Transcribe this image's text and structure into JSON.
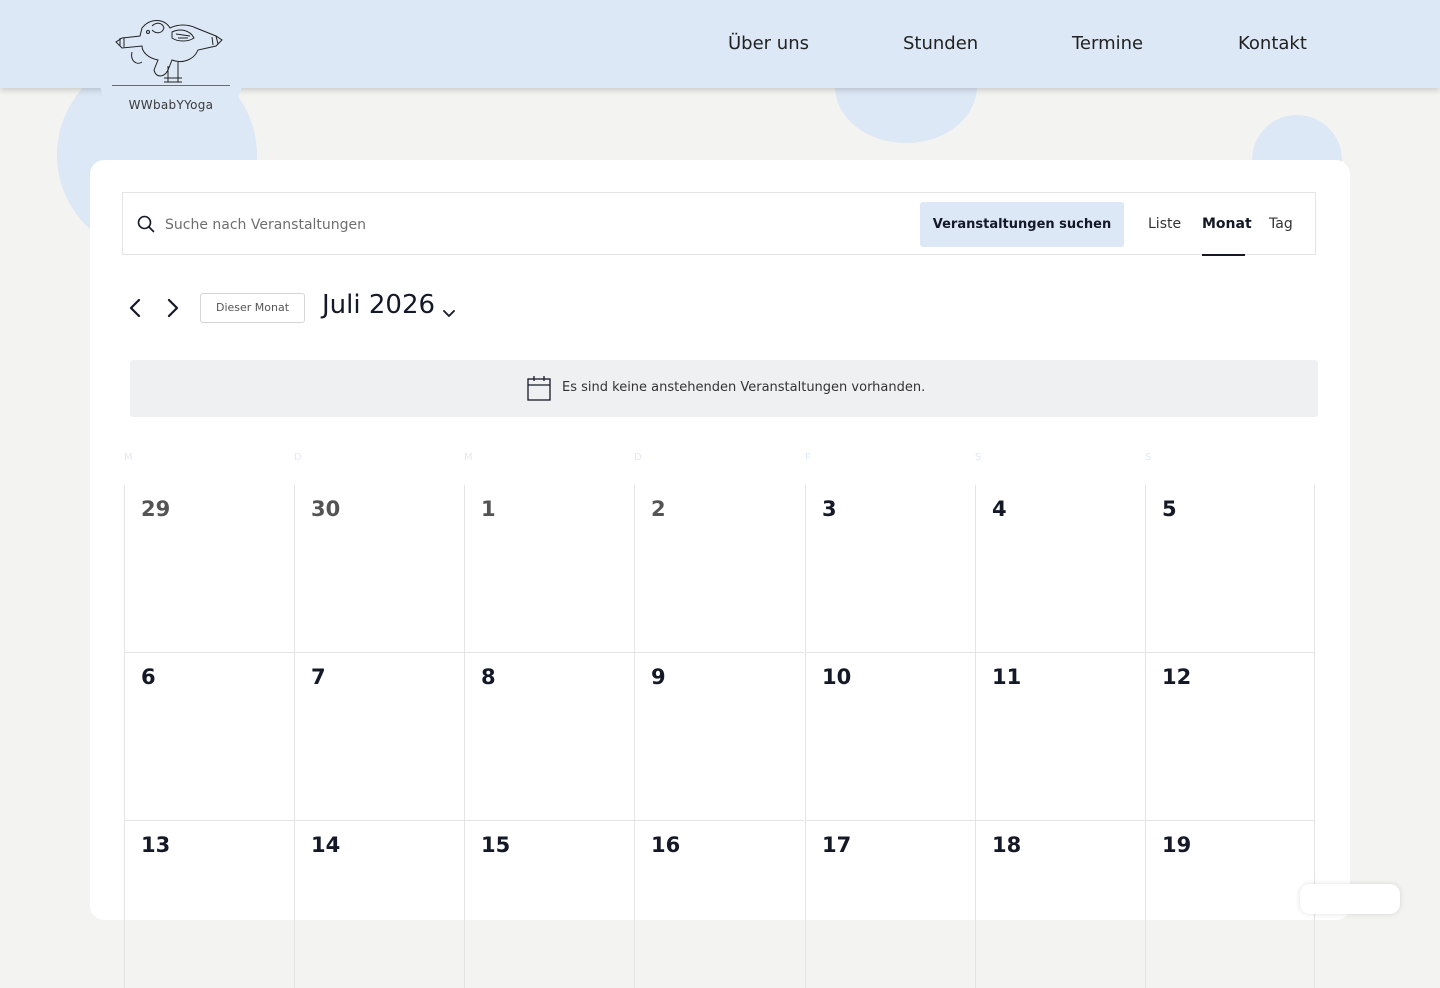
{
  "site": {
    "logo_text": "WWbabYYoga"
  },
  "nav": [
    {
      "label": "Über uns"
    },
    {
      "label": "Stunden"
    },
    {
      "label": "Termine"
    },
    {
      "label": "Kontakt"
    }
  ],
  "search": {
    "placeholder": "Suche nach Veranstaltungen",
    "value": "",
    "button_label": "Veranstaltungen suchen",
    "icon": "search-icon"
  },
  "views": [
    {
      "label": "Liste",
      "active": false
    },
    {
      "label": "Monat",
      "active": true
    },
    {
      "label": "Tag",
      "active": false
    }
  ],
  "month_nav": {
    "prev_icon": "chevron-left-icon",
    "next_icon": "chevron-right-icon",
    "this_month_label": "Dieser Monat",
    "title": "Juli 2026",
    "dropdown_icon": "chevron-down-icon"
  },
  "notice": {
    "icon": "calendar-icon",
    "text": "Es sind keine anstehenden Veranstaltungen vorhanden."
  },
  "weekdays": [
    "M",
    "D",
    "M",
    "D",
    "F",
    "S",
    "S"
  ],
  "calendar": {
    "weeks": [
      [
        "29",
        "30",
        "1",
        "2",
        "3",
        "4",
        "5"
      ],
      [
        "6",
        "7",
        "8",
        "9",
        "10",
        "11",
        "12"
      ],
      [
        "13",
        "14",
        "15",
        "16",
        "17",
        "18",
        "19"
      ]
    ],
    "past_days": [
      "29",
      "30",
      "1",
      "2"
    ]
  },
  "colors": {
    "accent": "#dce8f5",
    "text_dark": "#141827",
    "notice_bg": "#eff0f1",
    "grid_line": "#e4e4e4",
    "background": "#f3f3f1"
  }
}
